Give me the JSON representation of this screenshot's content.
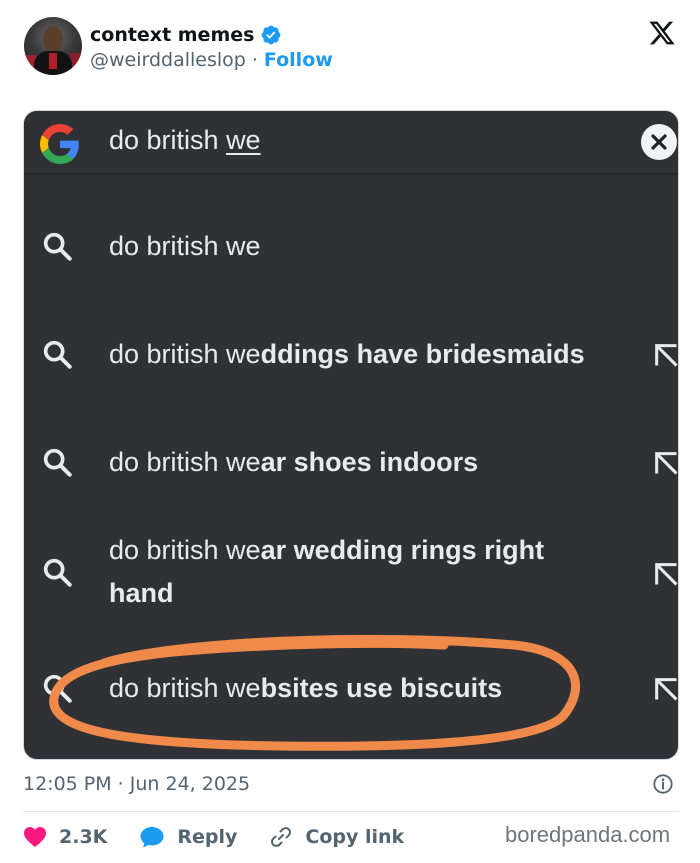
{
  "post": {
    "display_name": "context memes",
    "handle": "@weirddalleslop",
    "separator": "·",
    "follow_label": "Follow",
    "timestamp": "12:05 PM · Jun 24, 2025",
    "likes": "2.3K",
    "reply_label": "Reply",
    "copy_link_label": "Copy link",
    "watermark": "boredpanda.com"
  },
  "screenshot": {
    "query_prefix": "do british ",
    "query_underlined": "we",
    "suggestions": [
      {
        "plain": "do british we",
        "bold": "",
        "line2": "",
        "arrow": false
      },
      {
        "plain": "do british we",
        "bold": "ddings have bridesmaids",
        "line2": "",
        "arrow": true
      },
      {
        "plain": "do british we",
        "bold": "ar shoes indoors",
        "line2": "",
        "arrow": true
      },
      {
        "plain": "do british we",
        "bold": "ar wedding rings right",
        "line2": "hand",
        "arrow": true
      },
      {
        "plain": "do british we",
        "bold": "bsites use biscuits",
        "line2": "",
        "arrow": true
      }
    ]
  },
  "colors": {
    "accent": "#1d9bf0",
    "like": "#f91880",
    "dark_bg": "#303134",
    "marker": "#f08a4b"
  },
  "icons": [
    "verified-badge-icon",
    "x-logo-icon",
    "google-logo-icon",
    "clear-icon",
    "search-icon",
    "fill-arrow-icon",
    "info-icon",
    "heart-icon",
    "reply-bubble-icon",
    "link-icon"
  ]
}
